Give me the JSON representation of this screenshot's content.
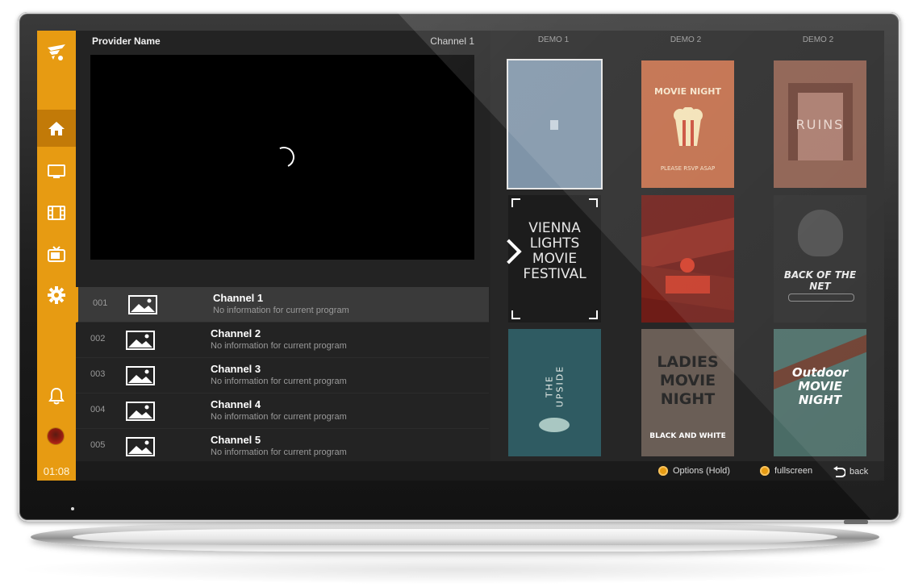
{
  "header": {
    "provider_name": "Provider Name",
    "channel_name": "Channel 1"
  },
  "sidebar": {
    "items": [
      {
        "icon": "home-icon"
      },
      {
        "icon": "tv-icon"
      },
      {
        "icon": "film-icon"
      },
      {
        "icon": "retro-tv-icon"
      },
      {
        "icon": "gear-icon"
      }
    ],
    "clock": "01:08"
  },
  "channels": [
    {
      "number": "001",
      "title": "Channel 1",
      "desc": "No information for current program"
    },
    {
      "number": "002",
      "title": "Channel 2",
      "desc": "No information for current program"
    },
    {
      "number": "003",
      "title": "Channel 3",
      "desc": "No information for current program"
    },
    {
      "number": "004",
      "title": "Channel 4",
      "desc": "No information for current program"
    },
    {
      "number": "005",
      "title": "Channel 5",
      "desc": "No information for current program"
    }
  ],
  "posters": {
    "columns": [
      "DEMO 1",
      "DEMO 2",
      "DEMO 2"
    ],
    "items": [
      {
        "title": "",
        "bg": "#7f94a8"
      },
      {
        "title": "MOVIE NIGHT",
        "subtitle": "PLEASE RSVP ASAP",
        "bg": "#c06b47"
      },
      {
        "title": "RUINS",
        "bg": "#8a5b4b"
      },
      {
        "title": "VIENNA LIGHTS MOVIE FESTIVAL",
        "bg": "#1c1c1c"
      },
      {
        "title": "",
        "bg": "#6e1c17"
      },
      {
        "title": "BACK OF THE NET",
        "bg": "#2b2b2b"
      },
      {
        "title": "THE UPSIDE",
        "bg": "#2f5b62"
      },
      {
        "title": "LADIES MOVIE NIGHT",
        "subtitle": "BLACK AND WHITE",
        "bg": "#6a5e56"
      },
      {
        "title": "Outdoor MOVIE NIGHT",
        "bg": "#4a6c66"
      }
    ]
  },
  "footer": {
    "options": "Options (Hold)",
    "fullscreen": "fullscreen",
    "back": "back"
  },
  "colors": {
    "accent": "#e79b12",
    "background": "#232323"
  }
}
